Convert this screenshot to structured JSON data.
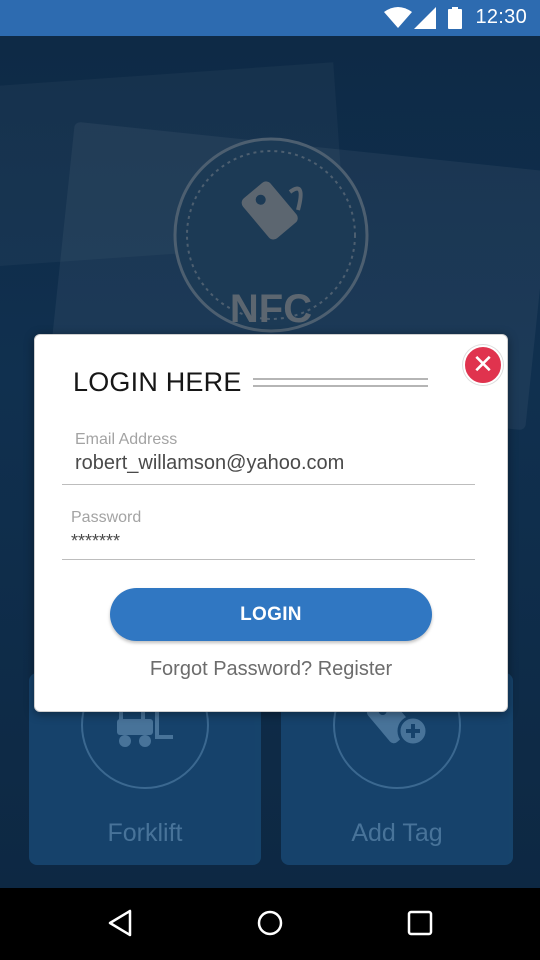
{
  "status_bar": {
    "time": "12:30"
  },
  "background": {
    "badge_text": "NFC",
    "tiles": [
      {
        "label": "Forklift",
        "icon": "forklift-icon"
      },
      {
        "label": "Add Tag",
        "icon": "add-tag-icon"
      }
    ]
  },
  "dialog": {
    "title": "LOGIN HERE",
    "close_icon": "close-icon",
    "email": {
      "label": "Email Address",
      "value": "robert_willamson@yahoo.com"
    },
    "password": {
      "label": "Password",
      "value": "*******"
    },
    "login_label": "LOGIN",
    "forgot_label": "Forgot Password?",
    "register_label": "Register"
  },
  "colors": {
    "status_bar": "#2d6bb0",
    "primary_button": "#3077c2",
    "close_button": "#e0334e",
    "background": "#0e2a46"
  },
  "nav_bar": {
    "icons": [
      "back-icon",
      "home-icon",
      "recents-icon"
    ]
  }
}
